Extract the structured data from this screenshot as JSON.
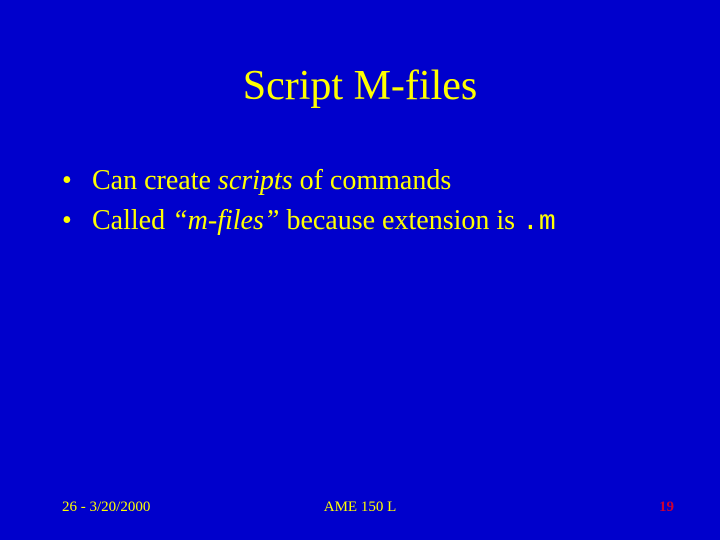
{
  "title": "Script M-files",
  "bullets": {
    "b1": {
      "dot": "•",
      "p1": "Can create ",
      "i1": "scripts",
      "p2": " of commands"
    },
    "b2": {
      "dot": "•",
      "p1": "Called ",
      "i1": "“m-files”",
      "p2": " because extension is ",
      "m1": ".m"
    }
  },
  "footer": {
    "left": "26 - 3/20/2000",
    "center": "AME 150 L",
    "right": "19"
  }
}
